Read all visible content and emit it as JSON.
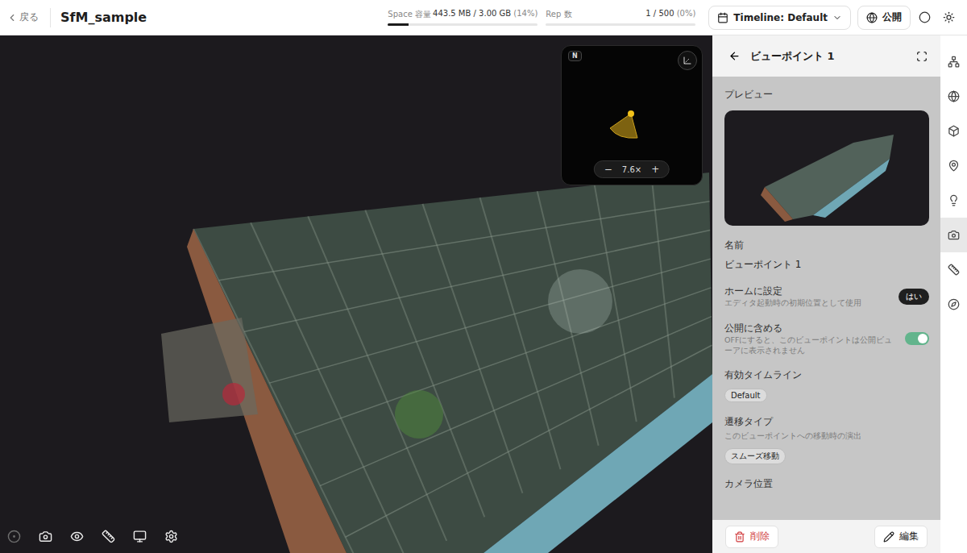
{
  "topbar": {
    "back": "戻る",
    "title": "SfM_sample",
    "meters": [
      {
        "label": "Space 容量",
        "reading": "443.5 MB / 3.00 GB",
        "percent": "(14%)",
        "level": 0.14
      },
      {
        "label": "Rep 数",
        "reading": "1 / 500",
        "percent": "(0%)",
        "level": 0
      }
    ],
    "timeline": "Timeline: Default",
    "publish": "公開"
  },
  "minimap": {
    "north": "N",
    "zoom_out": "−",
    "zoom": "7.6×",
    "zoom_in": "+"
  },
  "toolbar": [
    {
      "disabled": true
    },
    {
      "disabled": false
    },
    {
      "disabled": false
    },
    {
      "disabled": false
    },
    {
      "disabled": false
    },
    {
      "disabled": false
    }
  ],
  "panel": {
    "title": "ビューポイント 1",
    "preview_label": "プレビュー",
    "fields": [
      {
        "kind": "text",
        "label": "名前",
        "value": "ビューポイント 1"
      },
      {
        "kind": "badge",
        "label": "ホームに設定",
        "hint": "エディタ起動時の初期位置として使用",
        "value": "はい"
      },
      {
        "kind": "toggle",
        "label": "公開に含める",
        "hint": "OFFにすると、このビューポイントは公開ビューアに表示されません",
        "on": true
      },
      {
        "kind": "chip",
        "label": "有効タイムライン",
        "value": "Default"
      },
      {
        "kind": "chip",
        "label": "遷移タイプ",
        "hint": "このビューポイントへの移動時の演出",
        "value": "スムーズ移動"
      },
      {
        "kind": "heading",
        "label": "カメラ位置"
      }
    ],
    "delete": "削除",
    "edit": "編集"
  },
  "rail": [
    {
      "selected": false
    },
    {
      "selected": false
    },
    {
      "selected": false
    },
    {
      "selected": false
    },
    {
      "selected": false
    },
    {
      "selected": true
    },
    {
      "selected": false
    },
    {
      "selected": false
    }
  ]
}
